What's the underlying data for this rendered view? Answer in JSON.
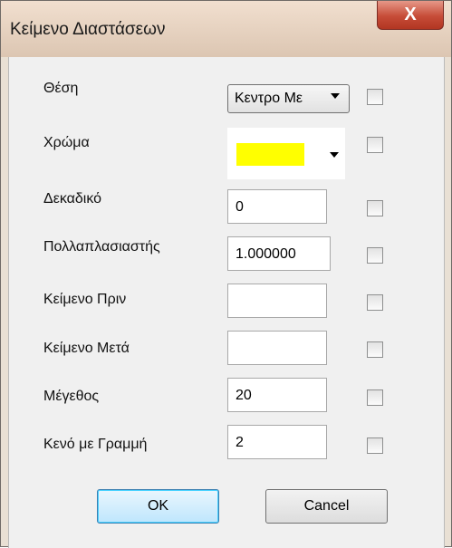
{
  "window": {
    "title": "Κείμενο Διαστάσεων",
    "close_label": "X"
  },
  "fields": {
    "position": {
      "label": "Θέση",
      "value": "Κεντρο Με"
    },
    "color": {
      "label": "Χρώμα",
      "value": "#ffff00"
    },
    "decimal": {
      "label": "Δεκαδικό",
      "value": "0"
    },
    "multiplier": {
      "label": "Πολλαπλασιαστής",
      "value": "1.000000"
    },
    "text_before": {
      "label": "Κείμενο Πριν",
      "value": ""
    },
    "text_after": {
      "label": "Κείμενο Μετά",
      "value": ""
    },
    "size": {
      "label": "Μέγεθος",
      "value": "20"
    },
    "gap_line": {
      "label": "Κενό με Γραμμή",
      "value": "2"
    }
  },
  "buttons": {
    "ok": "OK",
    "cancel": "Cancel"
  },
  "icons": {
    "close": "close-icon",
    "dropdown": "chevron-down-icon",
    "checkbox": "checkbox-icon"
  }
}
